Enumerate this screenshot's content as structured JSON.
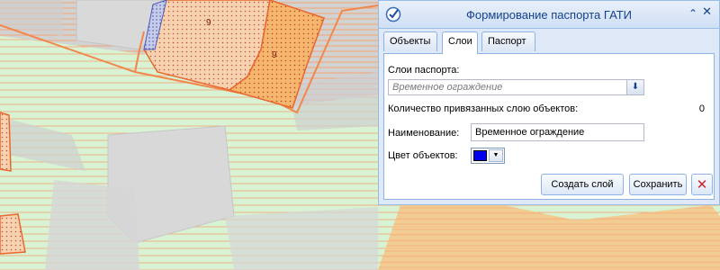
{
  "map": {
    "parcel_numbers": [
      "9",
      "9"
    ],
    "colors": {
      "background": "#d2d2d2",
      "green_zone": "#d7f3d2",
      "stripe": "#f4a273",
      "orange_zone": "#f7c687",
      "selected_parcel": "#f6cda7",
      "parcel_border": "#f1874a"
    }
  },
  "window": {
    "title": "Формирование паспорта ГАТИ",
    "title_icon": "check-shield-icon",
    "collapse_icon": "double-chevron-up-icon",
    "close_icon": "close-icon"
  },
  "tabs": [
    {
      "label": "Объекты",
      "active": false
    },
    {
      "label": "Слои",
      "active": true
    },
    {
      "label": "Паспорт",
      "active": false
    }
  ],
  "form": {
    "layers_label": "Слои паспорта:",
    "layer_selected": "Временное ограждение",
    "count_label": "Количество привязанных слою объектов:",
    "count_value": "0",
    "name_label": "Наименование:",
    "name_value": "Временное ограждение",
    "color_label": "Цвет объектов:",
    "color_value": "#0000ee"
  },
  "buttons": {
    "create": "Создать слой",
    "save": "Сохранить",
    "cancel_icon": "close-icon"
  }
}
